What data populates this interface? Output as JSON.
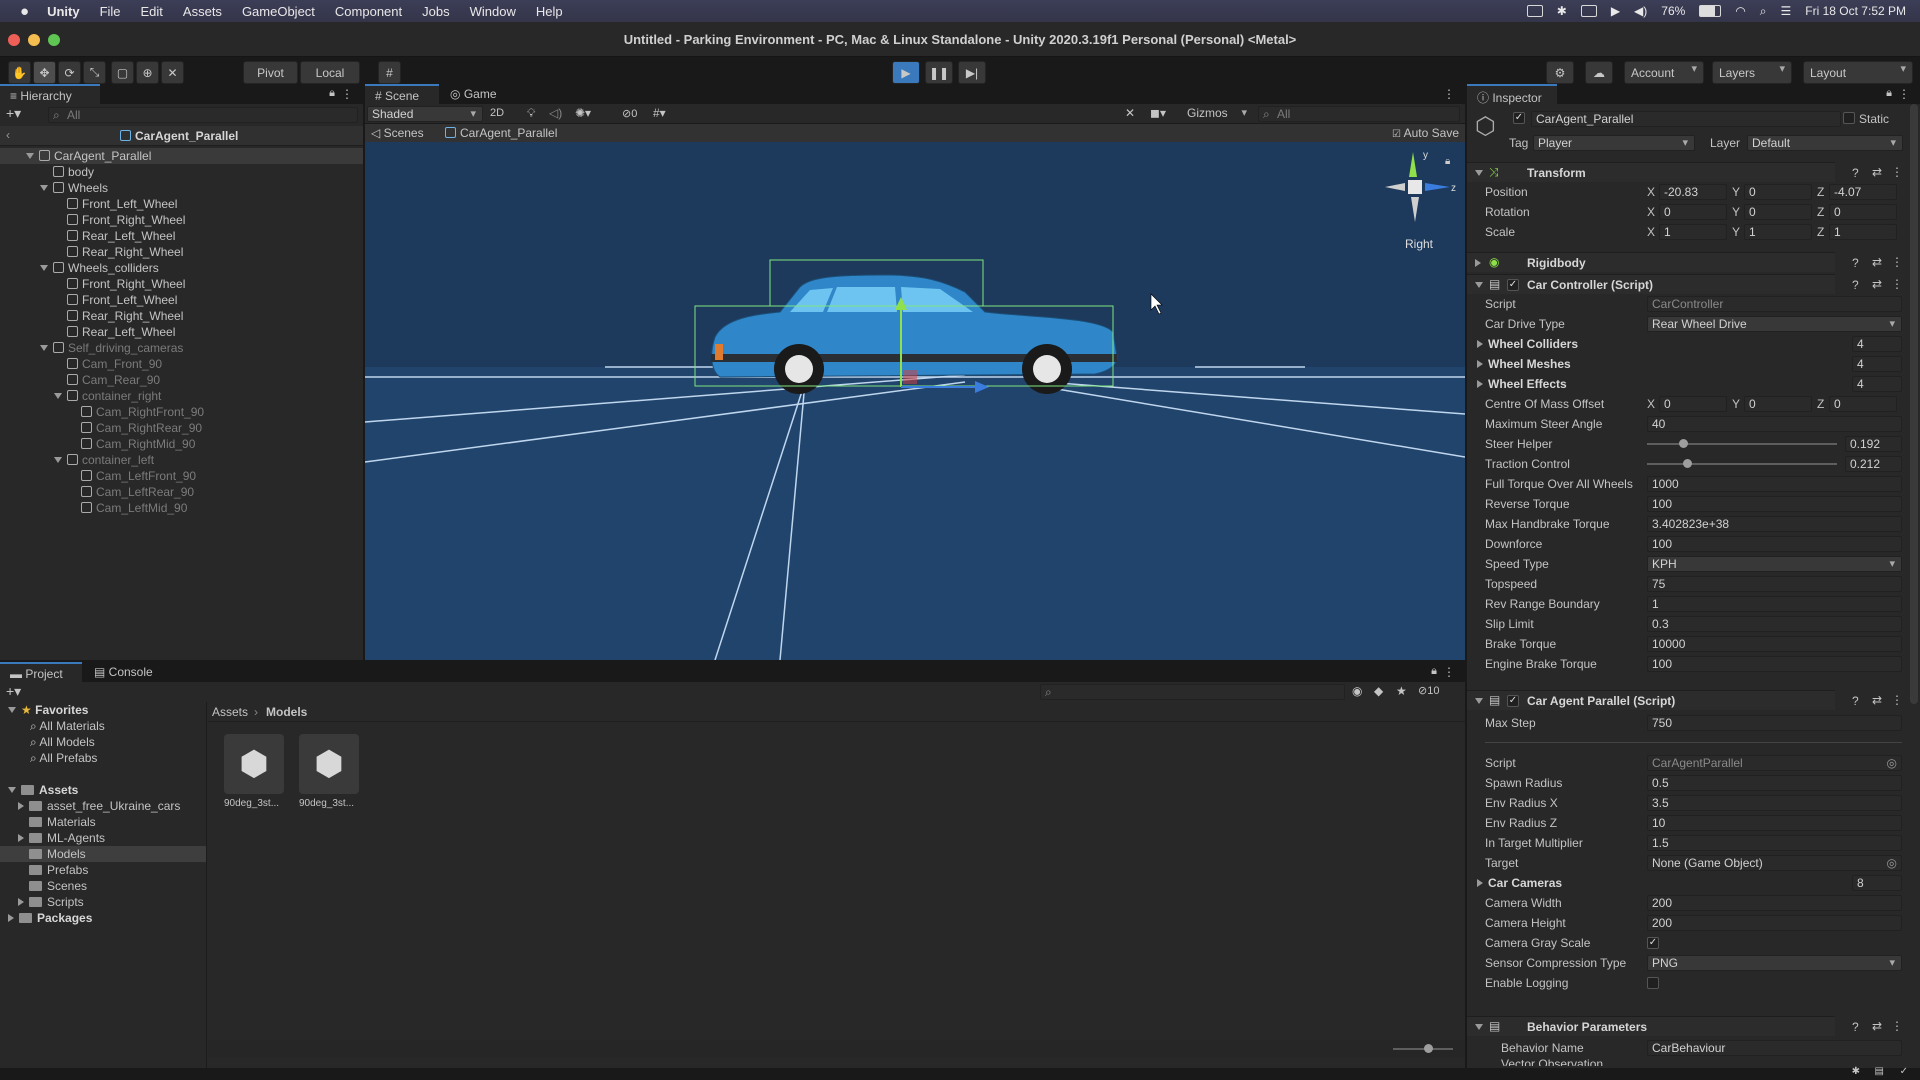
{
  "menubar": {
    "app": "Unity",
    "items": [
      "File",
      "Edit",
      "Assets",
      "GameObject",
      "Component",
      "Jobs",
      "Window",
      "Help"
    ],
    "battery": "76%",
    "datetime": "Fri 18 Oct  7:52 PM"
  },
  "window": {
    "title": "Untitled - Parking Environment - PC, Mac & Linux Standalone - Unity 2020.3.19f1 Personal (Personal) <Metal>"
  },
  "toolbar": {
    "pivot": "Pivot",
    "local": "Local",
    "account": "Account",
    "layers": "Layers",
    "layout": "Layout"
  },
  "hierarchy": {
    "tab": "Hierarchy",
    "search": "All",
    "scene": "CarAgent_Parallel",
    "items": [
      {
        "label": "CarAgent_Parallel"
      },
      {
        "label": "body"
      },
      {
        "label": "Wheels"
      },
      {
        "label": "Front_Left_Wheel"
      },
      {
        "label": "Front_Right_Wheel"
      },
      {
        "label": "Rear_Left_Wheel"
      },
      {
        "label": "Rear_Right_Wheel"
      },
      {
        "label": "Wheels_colliders"
      },
      {
        "label": "Front_Right_Wheel"
      },
      {
        "label": "Front_Left_Wheel"
      },
      {
        "label": "Rear_Right_Wheel"
      },
      {
        "label": "Rear_Left_Wheel"
      },
      {
        "label": "Self_driving_cameras"
      },
      {
        "label": "Cam_Front_90"
      },
      {
        "label": "Cam_Rear_90"
      },
      {
        "label": "container_right"
      },
      {
        "label": "Cam_RightFront_90"
      },
      {
        "label": "Cam_RightRear_90"
      },
      {
        "label": "Cam_RightMid_90"
      },
      {
        "label": "container_left"
      },
      {
        "label": "Cam_LeftFront_90"
      },
      {
        "label": "Cam_LeftRear_90"
      },
      {
        "label": "Cam_LeftMid_90"
      }
    ]
  },
  "scene": {
    "tab_scene": "Scene",
    "tab_game": "Game",
    "shading": "Shaded",
    "mode2d": "2D",
    "hidden_count": "0",
    "gizmos": "Gizmos",
    "search": "All",
    "breadcrumb_root": "Scenes",
    "breadcrumb_prefab": "CarAgent_Parallel",
    "autosave": "Auto Save",
    "orientation": "Right",
    "axis_y": "y",
    "axis_z": "z",
    "colors": {
      "sky": "#1d3b5c",
      "ground": "#1f4872",
      "car": "#2f86c9"
    }
  },
  "project": {
    "tab_project": "Project",
    "tab_console": "Console",
    "favorites": "Favorites",
    "fav_items": [
      "All Materials",
      "All Models",
      "All Prefabs"
    ],
    "assets": "Assets",
    "asset_items": [
      "asset_free_Ukraine_cars",
      "Materials",
      "ML-Agents",
      "Models",
      "Prefabs",
      "Scenes",
      "Scripts"
    ],
    "packages": "Packages",
    "breadcrumb_root": "Assets",
    "breadcrumb_current": "Models",
    "hidden_count": "10",
    "files": [
      "90deg_3st...",
      "90deg_3st..."
    ]
  },
  "inspector": {
    "tab": "Inspector",
    "object_name": "CarAgent_Parallel",
    "static": "Static",
    "tag_label": "Tag",
    "tag": "Player",
    "layer_label": "Layer",
    "layer": "Default",
    "transform": {
      "title": "Transform",
      "position_label": "Position",
      "rotation_label": "Rotation",
      "scale_label": "Scale",
      "pos": [
        "-20.83",
        "0",
        "-4.07"
      ],
      "rot": [
        "0",
        "0",
        "0"
      ],
      "scale": [
        "1",
        "1",
        "1"
      ],
      "axes": [
        "X",
        "Y",
        "Z"
      ]
    },
    "rigidbody": "Rigidbody",
    "car_controller": {
      "title": "Car Controller (Script)",
      "rows": [
        {
          "label": "Script",
          "value": "CarController"
        },
        {
          "label": "Car Drive Type",
          "value": "Rear Wheel Drive"
        },
        {
          "label": "Wheel Colliders",
          "value": "4"
        },
        {
          "label": "Wheel Meshes",
          "value": "4"
        },
        {
          "label": "Wheel Effects",
          "value": "4"
        },
        {
          "label": "Centre Of Mass Offset",
          "value": ""
        },
        {
          "label": "Maximum Steer Angle",
          "value": "40"
        },
        {
          "label": "Steer Helper",
          "value": "0.192"
        },
        {
          "label": "Traction Control",
          "value": "0.212"
        },
        {
          "label": "Full Torque Over All Wheels",
          "value": "1000"
        },
        {
          "label": "Reverse Torque",
          "value": "100"
        },
        {
          "label": "Max Handbrake Torque",
          "value": "3.402823e+38"
        },
        {
          "label": "Downforce",
          "value": "100"
        },
        {
          "label": "Speed Type",
          "value": "KPH"
        },
        {
          "label": "Topspeed",
          "value": "75"
        },
        {
          "label": "Rev Range Boundary",
          "value": "1"
        },
        {
          "label": "Slip Limit",
          "value": "0.3"
        },
        {
          "label": "Brake Torque",
          "value": "10000"
        },
        {
          "label": "Engine Brake Torque",
          "value": "100"
        }
      ],
      "com": [
        "0",
        "0",
        "0"
      ],
      "steer_helper_fraction": 0.192,
      "traction_fraction": 0.212
    },
    "car_agent": {
      "title": "Car Agent Parallel (Script)",
      "max_step_label": "Max Step",
      "max_step": "750",
      "rows": [
        {
          "label": "Script",
          "value": "CarAgentParallel"
        },
        {
          "label": "Spawn Radius",
          "value": "0.5"
        },
        {
          "label": "Env Radius X",
          "value": "3.5"
        },
        {
          "label": "Env Radius Z",
          "value": "10"
        },
        {
          "label": "In Target Multiplier",
          "value": "1.5"
        },
        {
          "label": "Target",
          "value": "None (Game Object)"
        },
        {
          "label": "Car Cameras",
          "value": "8"
        },
        {
          "label": "Camera Width",
          "value": "200"
        },
        {
          "label": "Camera Height",
          "value": "200"
        },
        {
          "label": "Camera Gray Scale",
          "value": ""
        },
        {
          "label": "Sensor Compression Type",
          "value": "PNG"
        },
        {
          "label": "Enable Logging",
          "value": ""
        }
      ]
    },
    "behavior": {
      "title": "Behavior Parameters",
      "name_label": "Behavior Name",
      "name": "CarBehaviour",
      "next_label": "Vector Observation"
    }
  }
}
